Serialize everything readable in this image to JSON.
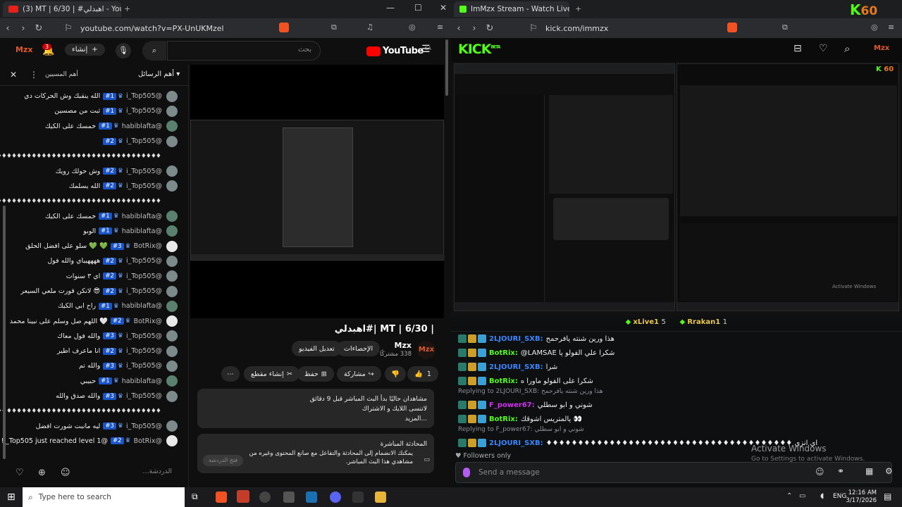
{
  "left_window": {
    "tab_title": "(3) MT | 6/30 | #اهبدلي - YouTube",
    "url": "youtube.com/watch?v=PX-UnUKMzel",
    "header": {
      "search_placeholder": "بحث",
      "logo_text": "YouTube",
      "logo_sup": "SA",
      "create_label": "إنشاء",
      "notif_count": "3"
    },
    "chat": {
      "header_title": "أهم الرسائل",
      "header_right": "أهم المسيين",
      "messages": [
        {
          "author": "@i_Top505",
          "badge": "#1",
          "text": "الله ينقبك وش الحركات دي",
          "av": "t"
        },
        {
          "author": "@i_Top505",
          "badge": "#1",
          "text": "ثبت من مصسين",
          "av": "t"
        },
        {
          "author": "@habiblafta",
          "badge": "#1",
          "text": "خمسك على الكيك",
          "av": "h"
        },
        {
          "author": "@i_Top505",
          "badge": "#2",
          "text": "",
          "av": "t"
        },
        {
          "sys": "♦♦♦♦♦♦♦♦♦♦♦♦♦♦♦♦♦♦♦♦♦♦♦♦♦♦♦♦♦♦♦♦♦♦♦♦♦♦♦♦♦♦♦♦"
        },
        {
          "author": "@i_Top505",
          "badge": "#2",
          "text": "وش حولك رويك",
          "av": "t"
        },
        {
          "author": "@i_Top505",
          "badge": "#2",
          "text": "الله يسلمك",
          "av": "t"
        },
        {
          "sys": "♦♦♦♦♦♦♦♦♦♦♦♦♦♦♦♦♦♦♦♦♦♦♦♦♦♦♦♦♦♦♦♦♦♦♦♦♦♦♦♦♦♦♦♦"
        },
        {
          "author": "@habiblafta",
          "badge": "#1",
          "text": "خمسك على الكيك",
          "av": "h"
        },
        {
          "author": "@habiblafta",
          "badge": "#1",
          "text": "الوبو",
          "av": "h"
        },
        {
          "author": "@BotRix",
          "badge": "#3",
          "text": "💚 💚 سلو على افضل الحلق",
          "av": "b"
        },
        {
          "author": "@i_Top505",
          "badge": "#2",
          "text": "ههههيباي والله فول",
          "av": "t"
        },
        {
          "author": "@i_Top505",
          "badge": "#2",
          "text": "اي ٣ سنوات",
          "av": "t"
        },
        {
          "author": "@i_Top505",
          "badge": "#2",
          "text": "😎 لاتكن قورت ملعي السيعر",
          "av": "t"
        },
        {
          "author": "@habiblafta",
          "badge": "#1",
          "text": "راح ابي الكيك",
          "av": "h"
        },
        {
          "author": "@BotRix",
          "badge": "#2",
          "text": "🤍 اللهم صل وسلم على نبينا محمد",
          "av": "b"
        },
        {
          "author": "@i_Top505",
          "badge": "#3",
          "text": "والله فول معاك",
          "av": "t"
        },
        {
          "author": "@i_Top505",
          "badge": "#2",
          "text": "انا ماعرف اطير",
          "av": "t"
        },
        {
          "author": "@i_Top505",
          "badge": "#3",
          "text": "والله تم",
          "av": "t"
        },
        {
          "author": "@habiblafta",
          "badge": "#1",
          "text": "حبيبي",
          "av": "h"
        },
        {
          "author": "@i_Top505",
          "badge": "#3",
          "text": "والله صدق والله",
          "av": "t"
        },
        {
          "sys": "♦♦♦♦♦♦♦♦♦♦♦♦♦♦♦♦♦♦♦♦♦♦♦♦♦♦♦♦♦♦♦♦♦♦♦♦♦♦♦♦♦♦♦♦"
        },
        {
          "author": "@i_Top505",
          "badge": "#3",
          "text": "ليه مانبت شورت افضل",
          "av": "t"
        },
        {
          "author": "@BotRix",
          "badge": "#2",
          "text": "@i_Top505 just reached level 1!",
          "av": "b"
        }
      ],
      "input_placeholder": "الدردشة..."
    },
    "video": {
      "title": "| MT | 6/30 |#اهبدلي",
      "channel": "Mzx",
      "subs": "338 مشتركًا",
      "btn_analytics": "الإحصاءات",
      "btn_edit": "تعديل الفيديو",
      "like_count": "1",
      "btn_share": "مشاركة",
      "btn_save": "حفظ",
      "btn_clip": "إنشاء مقطع",
      "desc_line1": "مشاهدان حاليًا  بدأ البث المباشر قبل 9 دقائق",
      "desc_line2": "لاتنسى اللايك و الاشتراك",
      "desc_more": "...المزيد",
      "live_chat_title": "المحادثة المباشرة",
      "live_chat_text": "يمكنك الانضمام إلى المحادثة والتفاعل مع صانع المحتوى وغيره من مشاهدي هذا البث المباشر.",
      "live_chat_btn": "فتح الدردشة"
    }
  },
  "right_window": {
    "tab_title": "ImMzx Stream - Watch Live on Kick",
    "url": "kick.com/immzx",
    "fps_label": "60",
    "logo": "KICK",
    "logo_sup": "BETA",
    "inner_fps": "60",
    "viewers": [
      {
        "name": "xLive1",
        "count": "5"
      },
      {
        "name": "Rrakan1",
        "count": "1"
      }
    ],
    "chat": [
      {
        "name": "2LJOURI_SXB:",
        "text": "هذا ورين شنته يافرحمح",
        "color": "#3a86ff"
      },
      {
        "name": "BotRix:",
        "text": "@LAMSAE شكرا علي الفولو يا",
        "color": "#53fc18"
      },
      {
        "name": "2LJOURI_SXB:",
        "text": "شرا",
        "color": "#3a86ff"
      },
      {
        "name": "BotRix:",
        "text": "شكرا على الفولو ماورا ه",
        "color": "#53fc18"
      },
      {
        "reply": "Replying to 2LJOURI_SXB: هذا ورين شنته يافرحمح"
      },
      {
        "name": "F_power67:",
        "text": "شوني و ابو سطلي",
        "color": "#d02ef0"
      },
      {
        "name": "BotRix:",
        "text": "يالمتريس اشوقك 👀",
        "color": "#53fc18"
      },
      {
        "reply": "Replying to F_power67: شوني و ابو سطلي"
      },
      {
        "name": "2LJOURI_SXB:",
        "text": "♦♦♦♦♦♦♦♦♦♦♦♦♦♦♦♦♦♦♦♦♦♦♦♦♦♦♦♦♦♦♦♦♦♦♦♦♦♦♦ اي انزي",
        "color": "#3a86ff"
      }
    ],
    "followers_only": "Followers only",
    "send_placeholder": "Send a message",
    "watermark_title": "Activate Windows",
    "watermark_sub": "Go to Settings to activate Windows."
  },
  "taskbar": {
    "search_placeholder": "Type here to search",
    "lang": "ENG",
    "time": "12:16 AM",
    "date": "3/17/2026"
  }
}
